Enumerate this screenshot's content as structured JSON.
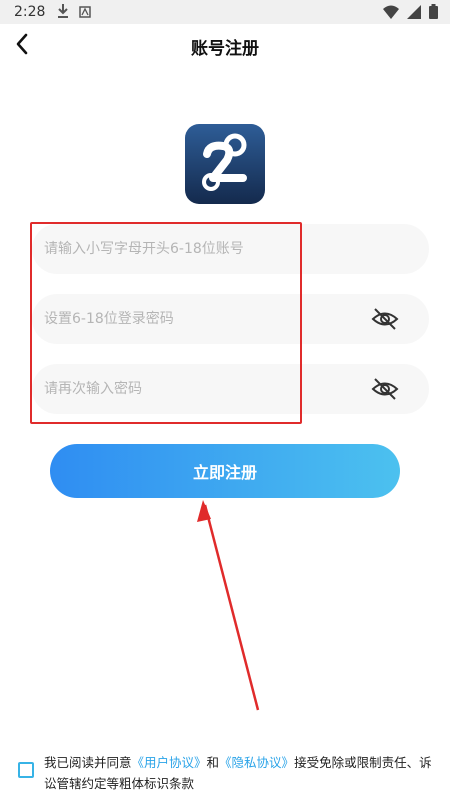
{
  "status_bar": {
    "time": "2:28"
  },
  "header": {
    "title": "账号注册"
  },
  "form": {
    "username_placeholder": "请输入小写字母开头6-18位账号",
    "password_placeholder": "设置6-18位登录密码",
    "confirm_placeholder": "请再次输入密码"
  },
  "actions": {
    "register_label": "立即注册"
  },
  "agreement": {
    "prefix": "我已阅读并同意",
    "user_link": "《用户协议》",
    "and": "和",
    "privacy_link": "《隐私协议》",
    "suffix": "接受免除或限制责任、诉讼管辖约定等粗体标识条款"
  },
  "colors": {
    "accent": "#37b3e6",
    "annotation": "#e02b2b"
  }
}
